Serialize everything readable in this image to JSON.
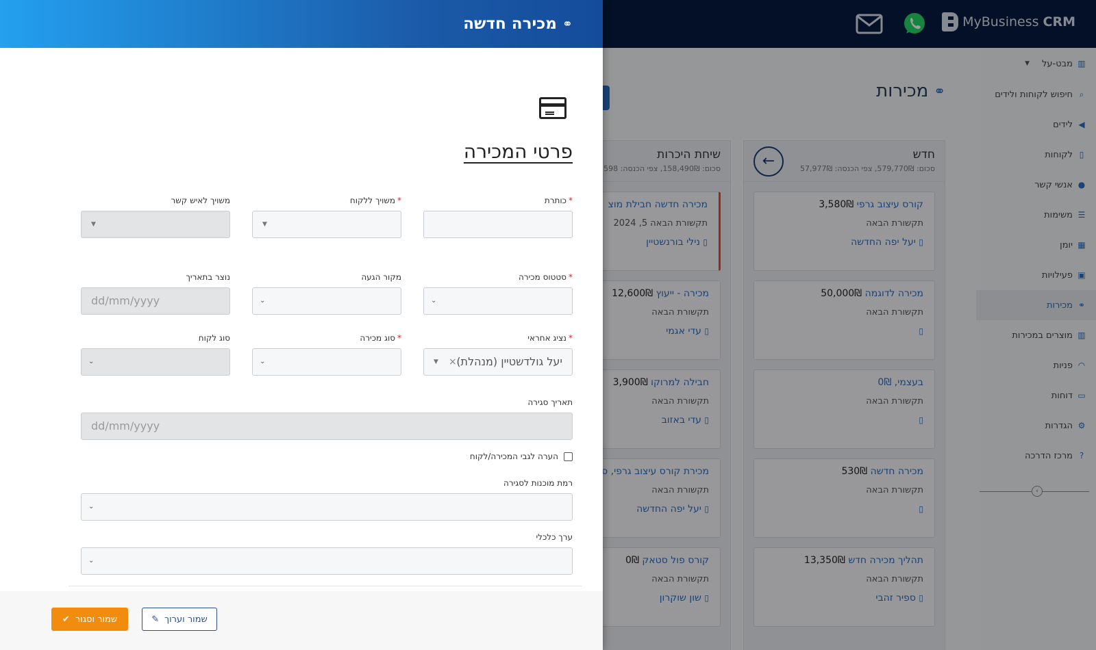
{
  "app": {
    "brand_prefix": "MyBusiness",
    "brand_suffix": "CRM"
  },
  "sidebar": {
    "items": [
      {
        "label": "מבט-על",
        "icon": "chart-icon"
      },
      {
        "label": "חיפוש לקוחות ולידים",
        "icon": "search-icon"
      },
      {
        "label": "לידים",
        "icon": "megaphone-icon"
      },
      {
        "label": "לקוחות",
        "icon": "building-icon"
      },
      {
        "label": "אנשי קשר",
        "icon": "person-icon"
      },
      {
        "label": "משימות",
        "icon": "list-icon"
      },
      {
        "label": "יומן",
        "icon": "calendar-icon"
      },
      {
        "label": "פעילויות",
        "icon": "calendar-check-icon"
      },
      {
        "label": "מכירות",
        "icon": "handshake-icon"
      },
      {
        "label": "מוצרים במכירות",
        "icon": "barcode-icon"
      },
      {
        "label": "פניות",
        "icon": "headset-icon"
      },
      {
        "label": "דוחות",
        "icon": "file-icon"
      },
      {
        "label": "הגדרות",
        "icon": "gear-icon"
      },
      {
        "label": "מרכז הדרכה",
        "icon": "question-icon"
      }
    ]
  },
  "main": {
    "title": "מכירות",
    "columns": [
      {
        "title": "חדש",
        "summary": "סכום: 579,770₪, צפי הכנסה: 57,977₪",
        "cards": [
          {
            "name": "קורס עיצוב גרפי",
            "amount": "3,580₪",
            "next": "תקשורת הבאה",
            "contact": "יעל יפה החדשה"
          },
          {
            "name": "מכירה לדוגמה",
            "amount": "50,000₪",
            "next": "תקשורת הבאה",
            "contact": ""
          },
          {
            "name": "בעצמי, 0₪",
            "amount": "",
            "next": "תקשורת הבאה",
            "contact": ""
          },
          {
            "name": "מכירה חדשה",
            "amount": "530₪",
            "next": "תקשורת הבאה",
            "contact": ""
          },
          {
            "name": "תהליך מכירה חדש",
            "amount": "13,350₪",
            "next": "תקשורת הבאה",
            "contact": "ספיר זהבי"
          }
        ]
      },
      {
        "title": "שיחת היכרות",
        "summary": "סכום: 158,490₪, צפי הכנסה: 598",
        "cards": [
          {
            "name": "מכירה חדשה חבילת מוצ",
            "amount": "",
            "next": "תקשורת הבאה",
            "date": "5, 2024",
            "contact": "נילי בורנשטיין"
          },
          {
            "name": "מכירה - ייעוץ",
            "amount": "12,600₪",
            "next": "תקשורת הבאה",
            "contact": "עדי אגמי"
          },
          {
            "name": "חבילה למרוקו",
            "amount": "3,900₪",
            "next": "תקשורת הבאה",
            "contact": "עדי באזוב"
          },
          {
            "name": "מכירת קורס עיצוב גרפי, ס",
            "amount": "",
            "next": "תקשורת הבאה",
            "contact": "יעל יפה החדשה"
          },
          {
            "name": "קורס פול סטאק",
            "amount": "0₪",
            "next": "תקשורת הבאה",
            "contact": "שון שוקרון"
          }
        ]
      }
    ]
  },
  "modal": {
    "title": "מכירה חדשה",
    "section_title": "פרטי המכירה",
    "fields": {
      "title": {
        "label": "כותרת",
        "value": ""
      },
      "customer": {
        "label": "משויך ללקוח",
        "value": ""
      },
      "contact": {
        "label": "משויך לאיש קשר",
        "value": ""
      },
      "status": {
        "label": "סטטוס מכירה",
        "value": ""
      },
      "source": {
        "label": "מקור הגעה",
        "value": ""
      },
      "created": {
        "label": "נוצר בתאריך",
        "placeholder": "dd/mm/yyyy"
      },
      "rep": {
        "label": "נציג אחראי",
        "value": "יעל גולדשטיין (מנהלת)"
      },
      "sale_type": {
        "label": "סוג מכירה",
        "value": ""
      },
      "customer_type": {
        "label": "סוג לקוח",
        "value": ""
      },
      "close_date": {
        "label": "תאריך סגירה",
        "placeholder": "dd/mm/yyyy"
      },
      "note_checkbox": {
        "label": "הערה לגבי המכירה/לקוח"
      },
      "readiness": {
        "label": "רמת מוכנות לסגירה",
        "value": ""
      },
      "value": {
        "label": "ערך כלכלי",
        "value": ""
      }
    },
    "buttons": {
      "save_edit": "שמור וערוך",
      "save_close": "שמור וסגור"
    }
  },
  "colors": {
    "accent": "#2a6cc2",
    "header_dark": "#071a42",
    "save_button": "#f28c0f",
    "required": "#e02020"
  }
}
